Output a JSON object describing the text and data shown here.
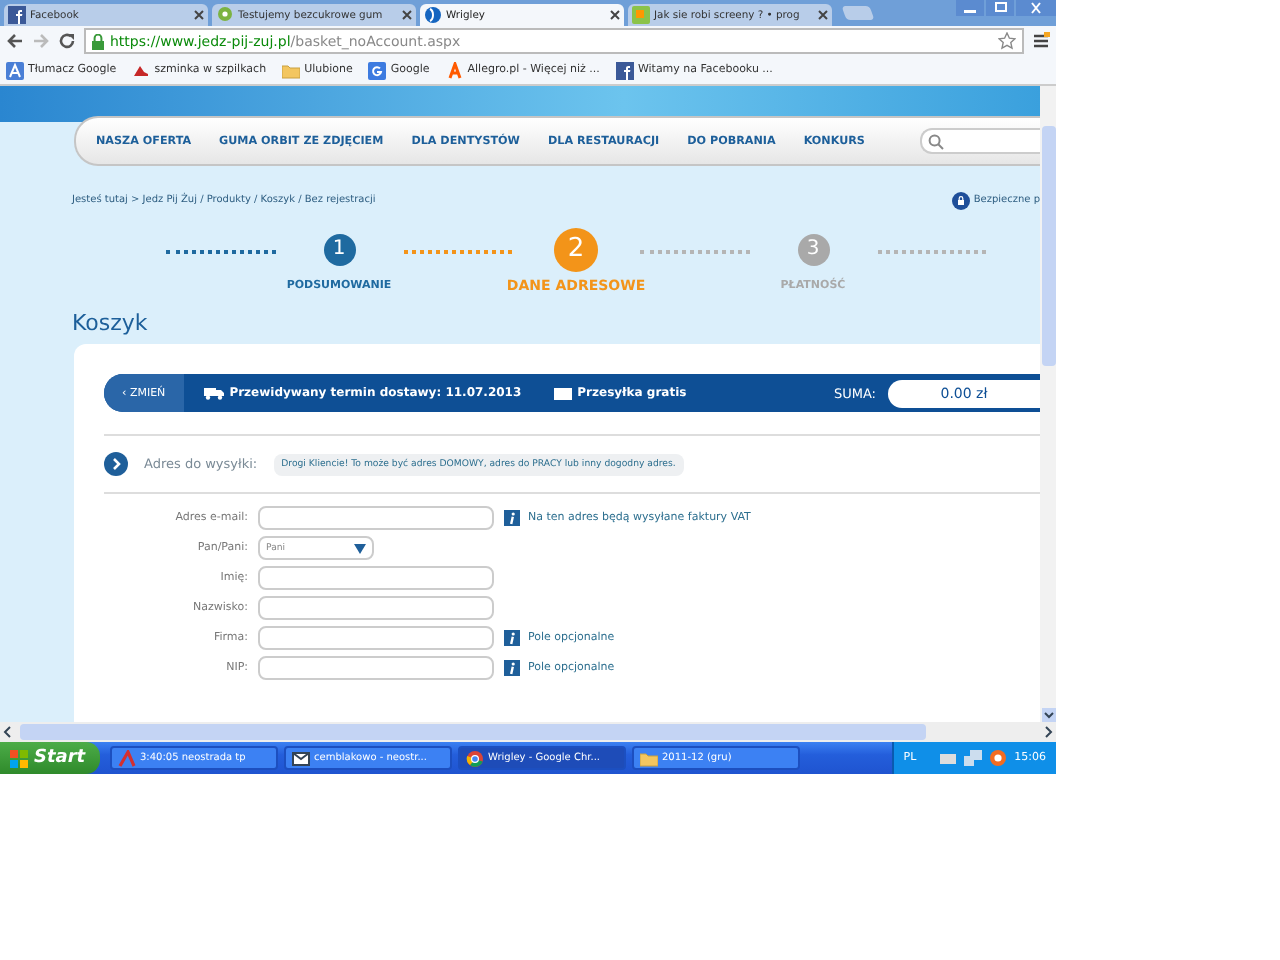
{
  "browser": {
    "tabs": [
      {
        "title": "Facebook",
        "selected": false
      },
      {
        "title": "Testujemy bezcukrowe gum",
        "selected": false
      },
      {
        "title": "Wrigley",
        "selected": true
      },
      {
        "title": "Jak sie robi screeny ? • prog",
        "selected": false
      }
    ],
    "url_host": "https://www.jedz-pij-zuj.pl",
    "url_path": "/basket_noAccount.aspx",
    "bookmarks": [
      "Tłumacz Google",
      "szminka w szpilkach",
      "Ulubione",
      "Google",
      "Allegro.pl - Więcej niż ...",
      "Witamy na Facebooku ..."
    ]
  },
  "site": {
    "nav": [
      "NASZA OFERTA",
      "GUMA ORBIT ZE ZDJĘCIEM",
      "DLA DENTYSTÓW",
      "DLA RESTAURACJI",
      "DO POBRANIA",
      "KONKURS"
    ],
    "breadcrumb": "Jesteś tutaj > Jedz Pij Żuj / Produkty / Koszyk / Bez rejestracji",
    "secure": "Bezpieczne p",
    "steps": [
      {
        "number": "1",
        "label": "PODSUMOWANIE",
        "completed": true,
        "selected": false
      },
      {
        "number": "2",
        "label": "DANE ADRESOWE",
        "completed": false,
        "selected": true
      },
      {
        "number": "3",
        "label": "PŁATNOŚĆ",
        "completed": false,
        "selected": false
      }
    ],
    "heading": "Koszyk",
    "cart_bar": {
      "change": "‹ ZMIEŃ",
      "delivery": "Przewidywany termin dostawy: 11.07.2013",
      "shipping": "Przesyłka gratis",
      "sum_label": "SUMA:",
      "sum": "0.00 zł"
    },
    "address": {
      "label": "Adres do wysyłki:",
      "hint": "Drogi Kliencie! To może być adres DOMOWY, adres do PRACY lub inny dogodny adres."
    },
    "fields": [
      {
        "label": "Adres e-mail:",
        "kind": "text",
        "note": "Na ten adres będą wysyłane faktury VAT"
      },
      {
        "label": "Pan/Pani:",
        "kind": "select",
        "value": "Pani"
      },
      {
        "label": "Imię:",
        "kind": "text"
      },
      {
        "label": "Nazwisko:",
        "kind": "text"
      },
      {
        "label": "Firma:",
        "kind": "text",
        "note": "Pole opcjonalne"
      },
      {
        "label": "NIP:",
        "kind": "text",
        "note": "Pole opcjonalne"
      }
    ]
  },
  "taskbar": {
    "start": "Start",
    "items": [
      {
        "title": "3:40:05 neostrada tp",
        "selected": false
      },
      {
        "title": "cemblakowo - neostr...",
        "selected": false
      },
      {
        "title": "Wrigley - Google Chr...",
        "selected": true
      },
      {
        "title": "2011-12 (gru)",
        "selected": false
      }
    ],
    "language": "PL",
    "time": "15:06"
  }
}
